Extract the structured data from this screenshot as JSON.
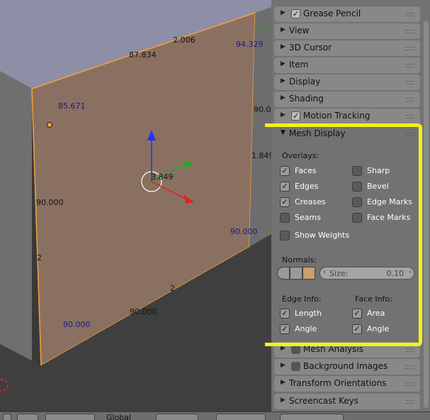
{
  "viewport": {
    "labels": [
      {
        "text": "2.006",
        "color": "black"
      },
      {
        "text": "87.834",
        "color": "black"
      },
      {
        "text": "94.329",
        "color": "blue"
      },
      {
        "text": "85.671",
        "color": "blue"
      },
      {
        "text": "90.0",
        "color": "black"
      },
      {
        "text": "1.849",
        "color": "black"
      },
      {
        "text": "3.849",
        "color": "black"
      },
      {
        "text": "90.000",
        "color": "black"
      },
      {
        "text": "90.000",
        "color": "blue"
      },
      {
        "text": "2",
        "color": "black"
      },
      {
        "text": "2",
        "color": "black"
      },
      {
        "text": "90.000",
        "color": "black"
      },
      {
        "text": "90.000",
        "color": "blue"
      }
    ],
    "colors": {
      "face": "#8a7060",
      "top": "#8e8ea6",
      "edge": "#f4a13a",
      "bg": "#393939"
    }
  },
  "panel": {
    "sections_top": [
      {
        "label": "Grease Pencil",
        "checkbox": true,
        "checked": true
      },
      {
        "label": "View",
        "checkbox": false
      },
      {
        "label": "3D Cursor",
        "checkbox": false
      },
      {
        "label": "Item",
        "checkbox": false
      },
      {
        "label": "Display",
        "checkbox": false
      },
      {
        "label": "Shading",
        "checkbox": false
      },
      {
        "label": "Motion Tracking",
        "checkbox": true,
        "checked": true
      }
    ],
    "mesh_display": {
      "title": "Mesh Display",
      "overlays_label": "Overlays:",
      "overlays_left": [
        {
          "label": "Faces",
          "checked": true
        },
        {
          "label": "Edges",
          "checked": true
        },
        {
          "label": "Creases",
          "checked": true
        },
        {
          "label": "Seams",
          "checked": false
        }
      ],
      "overlays_right": [
        {
          "label": "Sharp",
          "checked": false
        },
        {
          "label": "Bevel",
          "checked": false
        },
        {
          "label": "Edge Marks",
          "checked": false
        },
        {
          "label": "Face Marks",
          "checked": false
        }
      ],
      "show_weights": {
        "label": "Show Weights",
        "checked": false
      },
      "normals_label": "Normals:",
      "size_label": "Size:",
      "size_value": "0.10",
      "edge_info_label": "Edge Info:",
      "face_info_label": "Face Info:",
      "edge_info": [
        {
          "label": "Length",
          "checked": true
        },
        {
          "label": "Angle",
          "checked": true
        }
      ],
      "face_info": [
        {
          "label": "Area",
          "checked": true
        },
        {
          "label": "Angle",
          "checked": true
        }
      ]
    },
    "sections_bottom": [
      {
        "label": "Mesh Analysis",
        "checkbox": true,
        "checked": false
      },
      {
        "label": "Background Images",
        "checkbox": true,
        "checked": false
      },
      {
        "label": "Transform Orientations",
        "checkbox": false
      },
      {
        "label": "Screencast Keys",
        "checkbox": false
      }
    ]
  },
  "bottombar": {
    "orientation": "Global"
  },
  "highlight_color": "#f5f01a"
}
